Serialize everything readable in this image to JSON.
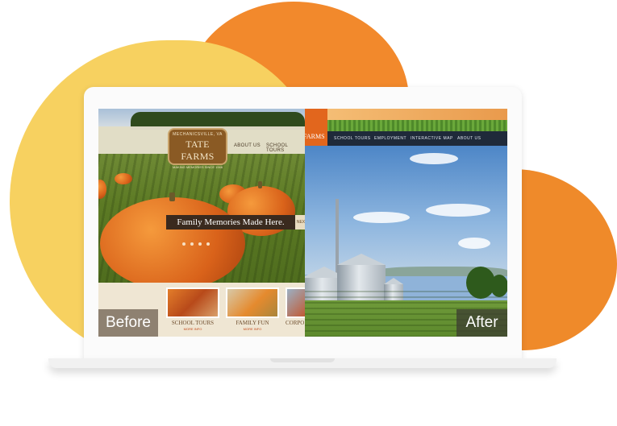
{
  "before": {
    "logo": {
      "top_text": "MECHANICSVILLE, VA",
      "title": "TATE FARMS",
      "subtitle": "MAKING MEMORIES SINCE 1946"
    },
    "nav": [
      "ABOUT US",
      "SCHOOL TOURS"
    ],
    "banner": "Family Memories Made Here.",
    "banner_next": "NEX",
    "cards": [
      {
        "title": "SCHOOL TOURS",
        "sub": "MORE INFO"
      },
      {
        "title": "FAMILY FUN",
        "sub": "MORE INFO"
      },
      {
        "title": "CORPO",
        "sub": ""
      }
    ],
    "tag": "Before"
  },
  "after": {
    "logo_text": "FARMS",
    "nav": [
      "SCHOOL TOURS",
      "EMPLOYMENT",
      "INTERACTIVE MAP",
      "ABOUT US"
    ],
    "tag": "After"
  },
  "colors": {
    "accent_orange": "#f2892c",
    "accent_yellow": "#f7d160",
    "after_nav": "#1f2a3a",
    "after_logo": "#e2661d"
  }
}
